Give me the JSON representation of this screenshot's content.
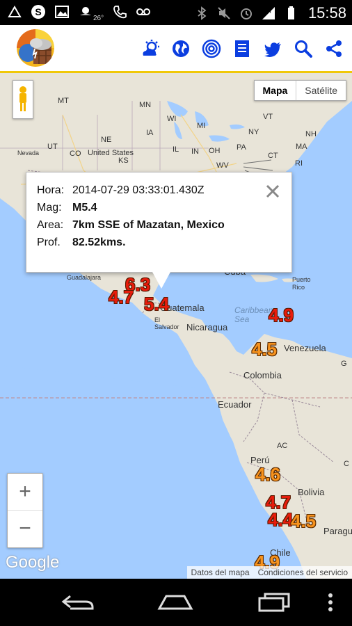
{
  "status_bar": {
    "temperature": "26°",
    "time": "15:58",
    "left_icons": [
      "google-s-icon",
      "image-icon",
      "weather-sun-icon",
      "phone-icon",
      "voicemail-icon"
    ],
    "right_icons": [
      "bluetooth-icon",
      "mute-icon",
      "alarm-icon",
      "signal-icon",
      "battery-icon"
    ]
  },
  "toolbar": {
    "icons": [
      "weather-icon",
      "globe-icon",
      "target-icon",
      "list-icon",
      "twitter-icon",
      "search-icon",
      "share-icon"
    ],
    "accent_color": "#0b3ee0"
  },
  "map": {
    "map_type": {
      "map_label": "Mapa",
      "satellite_label": "Satélite"
    },
    "labels": {
      "mt": "MT",
      "mn": "MN",
      "wi": "WI",
      "mi": "MI",
      "ny": "NY",
      "nh": "NH",
      "ma": "MA",
      "ct": "CT",
      "ri": "RI",
      "pa": "PA",
      "oh": "OH",
      "il": "IL",
      "in": "IN",
      "wv": "WV",
      "ia": "IA",
      "ne": "NE",
      "ut": "UT",
      "co": "CO",
      "ks": "KS",
      "nevada": "Nevada",
      "united_states": "United States",
      "vt": "VT",
      "guadalajara": "Guadalajara",
      "cuba": "Cuba",
      "puerto_rico": "Puerto\nRico",
      "caribbean_sea": "Caribbean\nSea",
      "guatemala": "Guatemala",
      "el_salvador": "El\nSalvador",
      "nicaragua": "Nicaragua",
      "venezuela": "Venezuela",
      "colombia": "Colombia",
      "ecuador": "Ecuador",
      "peru": "Perú",
      "bolivia": "Bolivia",
      "chile": "Chile",
      "paraguay": "Paragu",
      "ac": "AC",
      "c": "C",
      "g": "G"
    },
    "quakes": [
      "6.3",
      "4.7",
      "5.4",
      "4.9",
      "4.5",
      "4.6",
      "4.7",
      "4.4",
      "4.5",
      "4.9"
    ],
    "popup": {
      "hora_key": "Hora:",
      "hora_val": "2014-07-29 03:33:01.430Z",
      "mag_key": "Mag:",
      "mag_val": "M5.4",
      "area_key": "Area:",
      "area_val": "7km SSE of Mazatan, Mexico",
      "prof_key": "Prof.",
      "prof_val": "82.52kms."
    },
    "zoom": {
      "in": "+",
      "out": "−"
    },
    "google_logo": "Google",
    "attribution": {
      "map_data": "Datos del mapa",
      "terms": "Condiciones del servicio"
    }
  },
  "colors": {
    "quake_red": "#e81c0c",
    "quake_orange": "#f7931e",
    "water": "#a3ccff",
    "land": "#e8e4d8",
    "appbar_border": "#f0c808"
  }
}
